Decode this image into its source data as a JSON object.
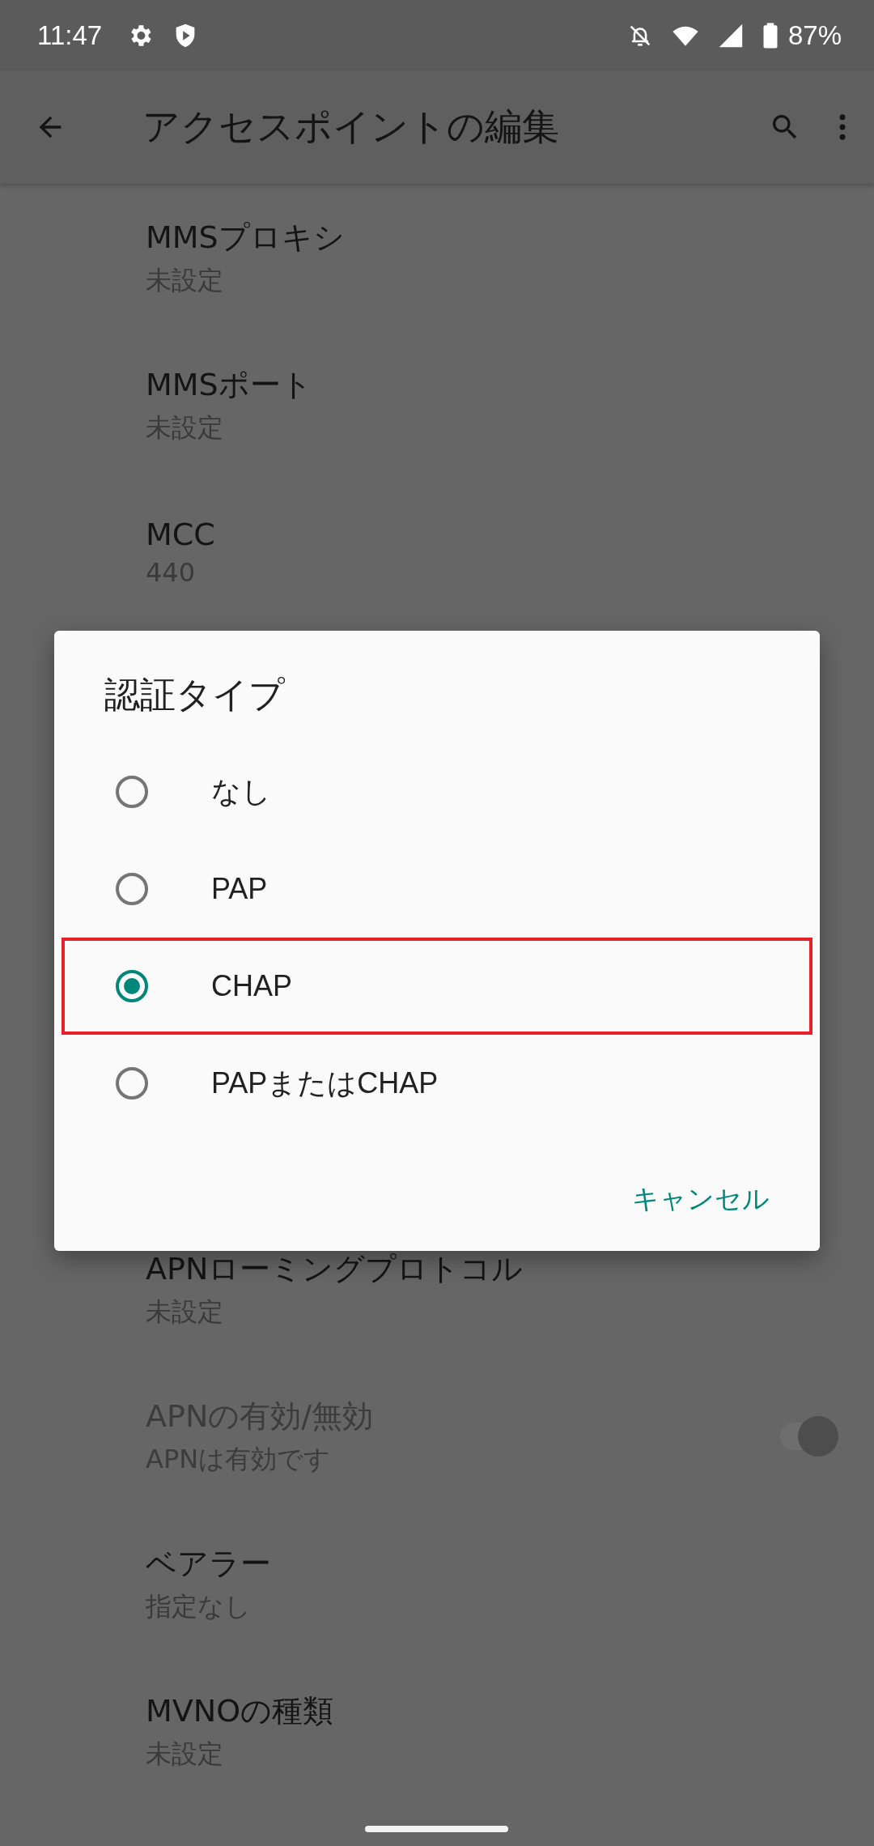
{
  "status_bar": {
    "time": "11:47",
    "battery": "87%"
  },
  "app_bar": {
    "title": "アクセスポイントの編集"
  },
  "settings_above": [
    {
      "kind": "text",
      "title": "MMSプロキシ",
      "summary": "未設定",
      "disabled": false
    },
    {
      "kind": "text",
      "title": "MMSポート",
      "summary": "未設定",
      "disabled": false
    },
    {
      "kind": "text",
      "title": "MCC",
      "summary": "440",
      "disabled": false
    }
  ],
  "settings_below": [
    {
      "kind": "text",
      "title": "APNローミングプロトコル",
      "summary": "未設定",
      "disabled": false
    },
    {
      "kind": "toggle",
      "title": "APNの有効/無効",
      "summary": "APNは有効です",
      "disabled": true,
      "on": true
    },
    {
      "kind": "text",
      "title": "ベアラー",
      "summary": "指定なし",
      "disabled": false
    },
    {
      "kind": "text",
      "title": "MVNOの種類",
      "summary": "未設定",
      "disabled": false
    }
  ],
  "dialog": {
    "title": "認証タイプ",
    "options": [
      {
        "label": "なし",
        "selected": false,
        "highlighted": false
      },
      {
        "label": "PAP",
        "selected": false,
        "highlighted": false
      },
      {
        "label": "CHAP",
        "selected": true,
        "highlighted": true
      },
      {
        "label": "PAPまたはCHAP",
        "selected": false,
        "highlighted": false
      }
    ],
    "cancel": "キャンセル"
  }
}
